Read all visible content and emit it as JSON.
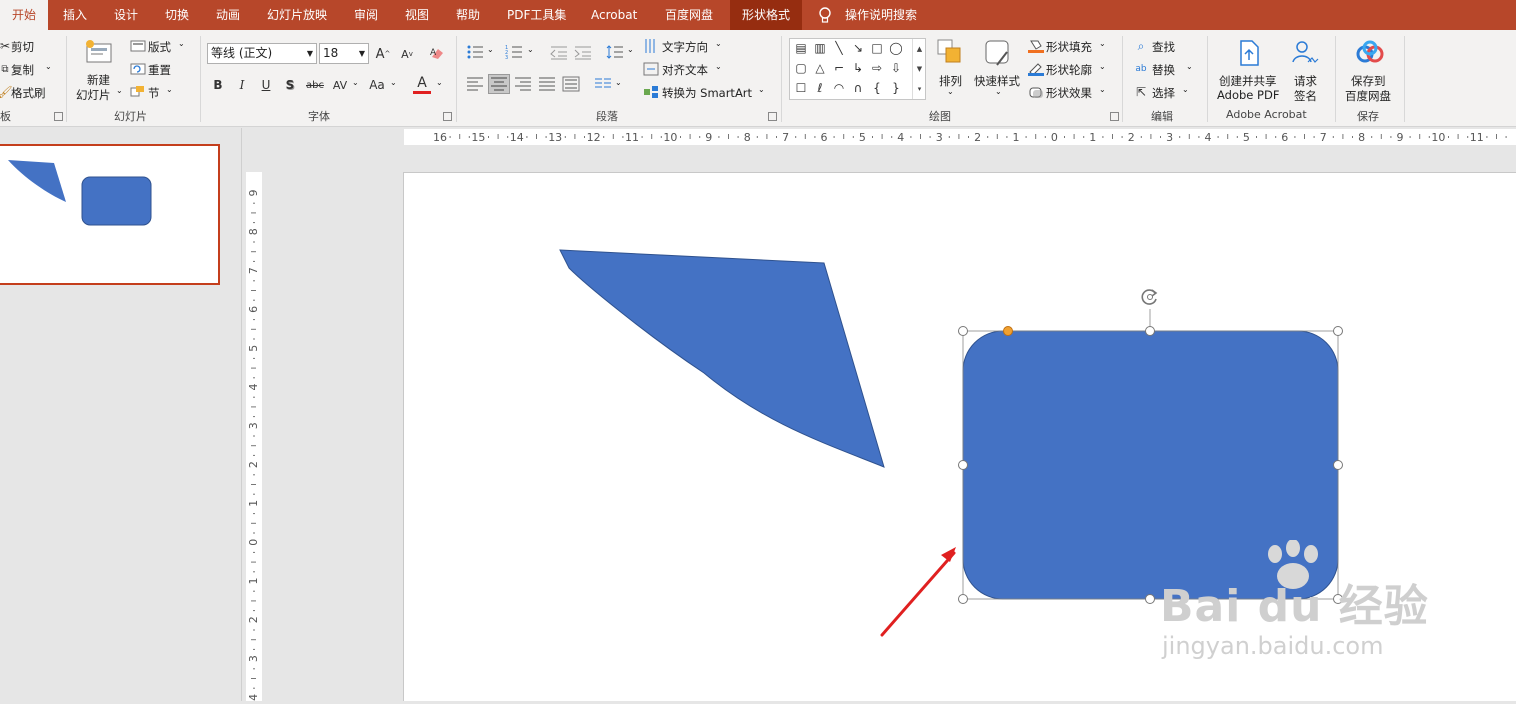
{
  "tabs": [
    "开始",
    "插入",
    "设计",
    "切换",
    "动画",
    "幻灯片放映",
    "审阅",
    "视图",
    "帮助",
    "PDF工具集",
    "Acrobat",
    "百度网盘",
    "形状格式"
  ],
  "tell_me": "操作说明搜索",
  "clipboard": {
    "cut": "剪切",
    "copy": "复制",
    "painter": "格式刷",
    "label": "板"
  },
  "slides": {
    "new_line1": "新建",
    "new_line2": "幻灯片",
    "layout": "版式",
    "reset": "重置",
    "section": "节",
    "label": "幻灯片"
  },
  "font": {
    "name": "等线 (正文)",
    "size": "18",
    "label": "字体",
    "bold": "B",
    "italic": "I",
    "underline": "U",
    "shadow": "S",
    "strike": "abc",
    "spacing": "AV",
    "case": "Aa",
    "grow": "A",
    "shrink": "A",
    "color": "A"
  },
  "paragraph": {
    "text_direction": "文字方向",
    "align_text": "对齐文本",
    "smartart": "转换为 SmartArt",
    "label": "段落"
  },
  "drawing": {
    "arrange": "排列",
    "quick_styles": "快速样式",
    "fill": "形状填充",
    "outline": "形状轮廓",
    "effects": "形状效果",
    "label": "绘图"
  },
  "editing": {
    "find": "查找",
    "replace": "替换",
    "select": "选择",
    "label": "编辑"
  },
  "acrobat": {
    "create_line1": "创建并共享",
    "create_line2": "Adobe PDF",
    "sign_line1": "请求",
    "sign_line2": "签名",
    "label": "Adobe Acrobat"
  },
  "save": {
    "line1": "保存到",
    "line2": "百度网盘",
    "label": "保存"
  },
  "hruler_nums": [
    "16",
    "15",
    "14",
    "13",
    "12",
    "11",
    "10",
    "9",
    "8",
    "7",
    "6",
    "5",
    "4",
    "3",
    "2",
    "1",
    "0",
    "1",
    "2",
    "3",
    "4",
    "5",
    "6",
    "7",
    "8",
    "9",
    "10",
    "11"
  ],
  "vruler_nums": [
    "9",
    "8",
    "7",
    "6",
    "5",
    "4",
    "3",
    "2",
    "1",
    "0",
    "1",
    "2",
    "3",
    "4"
  ],
  "watermark": {
    "brand": "Bai du 经验",
    "url": "jingyan.baidu.com"
  },
  "colors": {
    "accent": "#b7472a",
    "shape_fill": "#4472c4",
    "arrow": "#e02020"
  }
}
